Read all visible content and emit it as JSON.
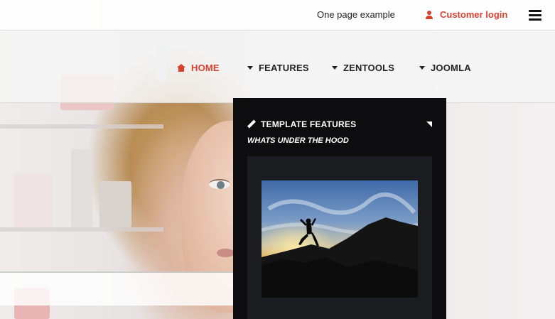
{
  "header": {
    "one_page_link": "One page example",
    "login_label": "Customer login",
    "login_icon": "user-icon",
    "menu_icon": "hamburger-icon",
    "accent_color": "#d9412f"
  },
  "nav": {
    "items": [
      {
        "label": "HOME",
        "icon": "home-icon",
        "active": true
      },
      {
        "label": "FEATURES",
        "icon": "caret-down-icon",
        "active": false
      },
      {
        "label": "ZENTOOLS",
        "icon": "caret-down-icon",
        "active": false
      },
      {
        "label": "JOOMLA",
        "icon": "caret-down-icon",
        "active": false
      }
    ]
  },
  "dropdown": {
    "title": "TEMPLATE FEATURES",
    "title_icon": "pencil-icon",
    "subtitle": "WHATS UNDER THE HOOD",
    "corner_icon": "corner-arrow-icon",
    "image_desc": "silhouette jumping at sunset"
  }
}
